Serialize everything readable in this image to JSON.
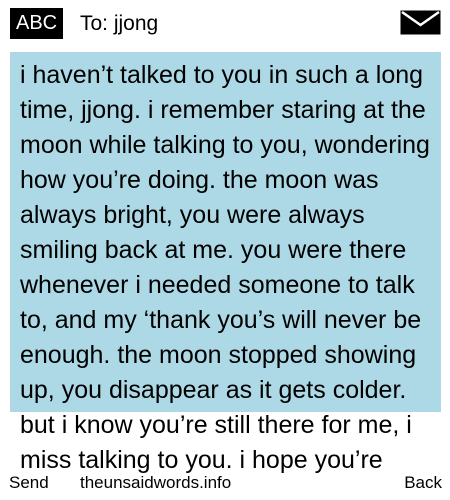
{
  "header": {
    "input_mode": "ABC",
    "recipient": "To: jjong",
    "icon": "envelope-icon"
  },
  "message": {
    "body": "i haven’t talked to you in such a long time, jjong. i remember staring at the moon while talking to you, wondering how you’re doing. the moon was always bright, you were always smiling back at me. you were there whenever i needed someone to talk to, and my ‘thank you’s will never be enough. the moon stopped showing up, you disappear as it gets colder. but i know you’re still there for me, i miss talking to you. i hope you’re"
  },
  "softkeys": {
    "left": "Send",
    "center": "theunsaidwords.info",
    "right": "Back"
  },
  "colors": {
    "message_background": "#add8e6",
    "badge_background": "#000000",
    "text": "#000000"
  }
}
